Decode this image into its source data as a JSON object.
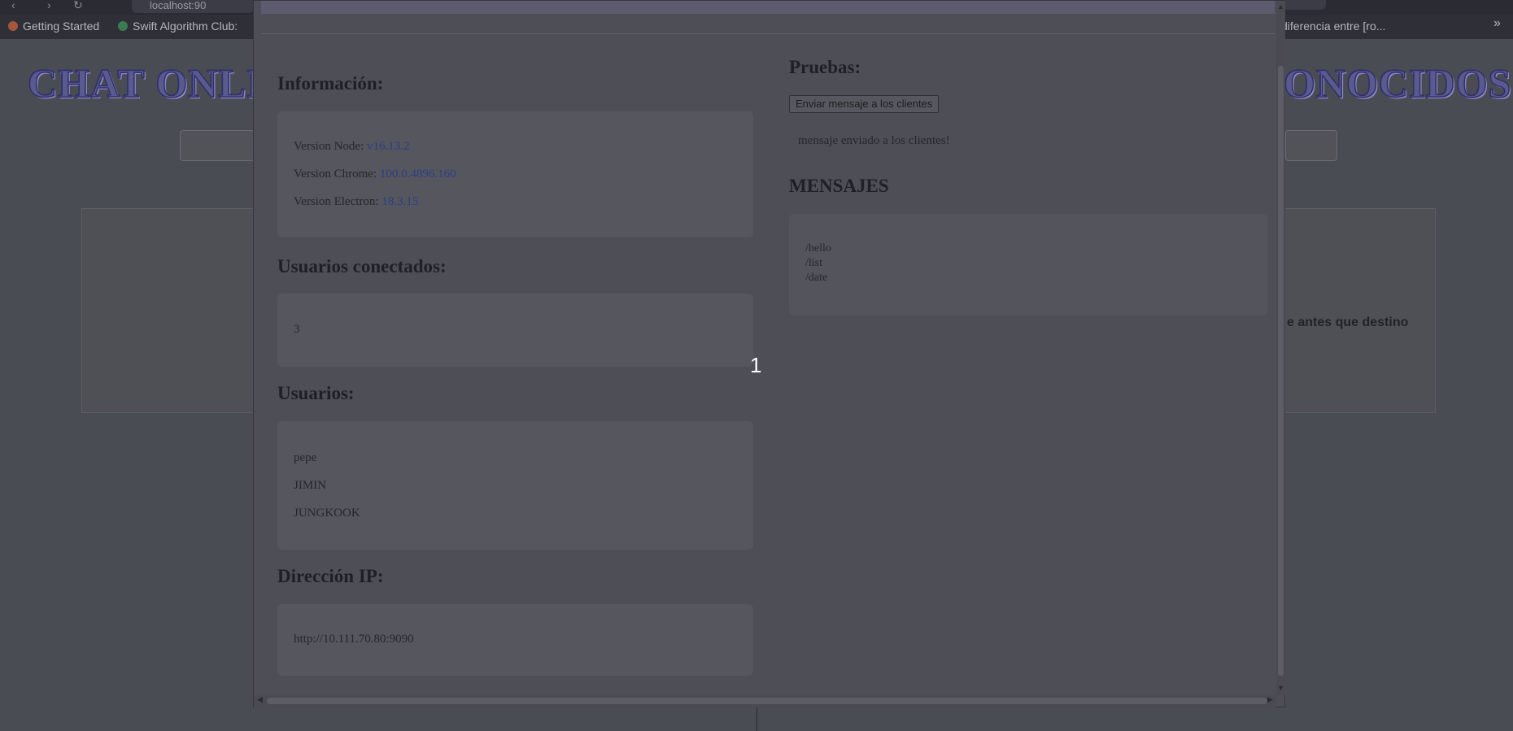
{
  "browser": {
    "url_fragment": "localhost:90",
    "bookmarks": [
      "Getting Started",
      "Swift Algorithm Club:",
      "diferencia entre [ro..."
    ]
  },
  "background_page": {
    "title_left": "CHAT ONLI",
    "title_right": "ONOCIDOS!",
    "card_text": "e antes que destino"
  },
  "info": {
    "heading": "Información:",
    "versions": [
      {
        "label": "Version Node:",
        "value": "v16.13.2"
      },
      {
        "label": "Version Chrome:",
        "value": "100.0.4896.160"
      },
      {
        "label": "Version Electron:",
        "value": "18.3.15"
      }
    ]
  },
  "connected": {
    "heading": "Usuarios conectados:",
    "count": "3"
  },
  "users": {
    "heading": "Usuarios:",
    "list": [
      "pepe",
      "JIMIN",
      "JUNGKOOK"
    ]
  },
  "ip": {
    "heading": "Dirección IP:",
    "address": "http://10.111.70.80:9090"
  },
  "tests": {
    "heading": "Pruebas:",
    "button_label": "Enviar mensaje a los clientes",
    "status": "mensaje enviado a los clientes!"
  },
  "messages": {
    "heading": "MENSAJES",
    "commands": [
      "/hello",
      "/list",
      "/date"
    ]
  },
  "overlay_number": "1",
  "colors": {
    "value_link": "#2a3f86",
    "title_fill": "#5b5a8e"
  }
}
